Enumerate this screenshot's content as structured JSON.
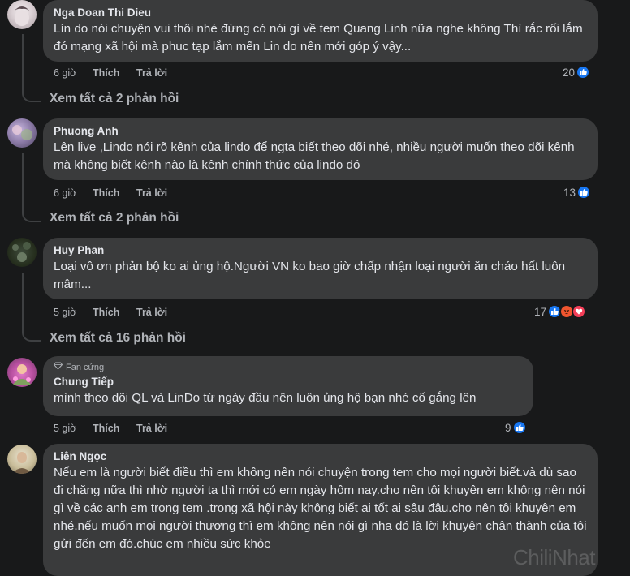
{
  "comments": [
    {
      "author": "Nga Doan Thi Dieu",
      "text": "Lín do nói chuyện vui thôi nhé đừng có nói gì về tem Quang Linh nữa nghe không Thì rắc rối lắm đó mạng xã hội mà phuc tạp lắm mến Lin do nên mới góp ý vậy...",
      "time": "6 giờ",
      "like_label": "Thích",
      "reply_label": "Trả lời",
      "reaction_count": "20",
      "reactions": [
        "like"
      ],
      "view_replies": "Xem tất cả 2 phản hồi"
    },
    {
      "author": "Phuong Anh",
      "text": "Lên live ,Lindo nói rõ kênh của lindo để ngta biết theo dõi nhé, nhiều người muốn theo dõi kênh mà không biết kênh nào là kênh chính thức của lindo đó",
      "time": "6 giờ",
      "like_label": "Thích",
      "reply_label": "Trả lời",
      "reaction_count": "13",
      "reactions": [
        "like"
      ],
      "view_replies": "Xem tất cả 2 phản hồi"
    },
    {
      "author": "Huy Phan",
      "text": "Loại vô ơn phản bộ ko ai ủng hộ.Người VN ko bao giờ chấp nhận loại người ăn cháo hất luôn mâm...",
      "time": "5 giờ",
      "like_label": "Thích",
      "reply_label": "Trả lời",
      "reaction_count": "17",
      "reactions": [
        "like",
        "angry",
        "love"
      ],
      "view_replies": "Xem tất cả 16 phản hồi"
    },
    {
      "badge": "Fan cứng",
      "author": "Chung Tiếp",
      "text": "mình theo dõi QL và LinDo từ ngày đầu nên luôn ủng hộ bạn nhé cố gắng lên",
      "time": "5 giờ",
      "like_label": "Thích",
      "reply_label": "Trả lời",
      "reaction_count": "9",
      "reactions": [
        "like"
      ]
    },
    {
      "author": "Liên Ngọc",
      "text": "Nếu em là người biết điều thì em không nên nói chuyện trong tem cho mọi người biết.và dù sao đi chăng nữa thì nhờ người ta thì mới có em ngày hôm nay.cho nên tôi khuyên em không nên nói gì về các anh em trong tem .trong xã hội này không biết ai tốt ai sâu đâu.cho nên tôi khuyên em nhé.nếu muốn mọi người thương thì em không nên nói gì nha đó là lời khuyên chân thành của tôi gửi đến em đó.chúc em nhiều sức khỏe"
    }
  ],
  "watermark": "ChiliNhat",
  "colors": {
    "background": "#18191a",
    "bubble": "#3a3b3c",
    "like_blue": "#1877f2",
    "angry": "#f0552f",
    "love": "#f33e58"
  },
  "icons": {
    "like": "thumbs-up-icon",
    "angry": "angry-face-icon",
    "love": "heart-icon",
    "badge": "diamond-icon"
  }
}
